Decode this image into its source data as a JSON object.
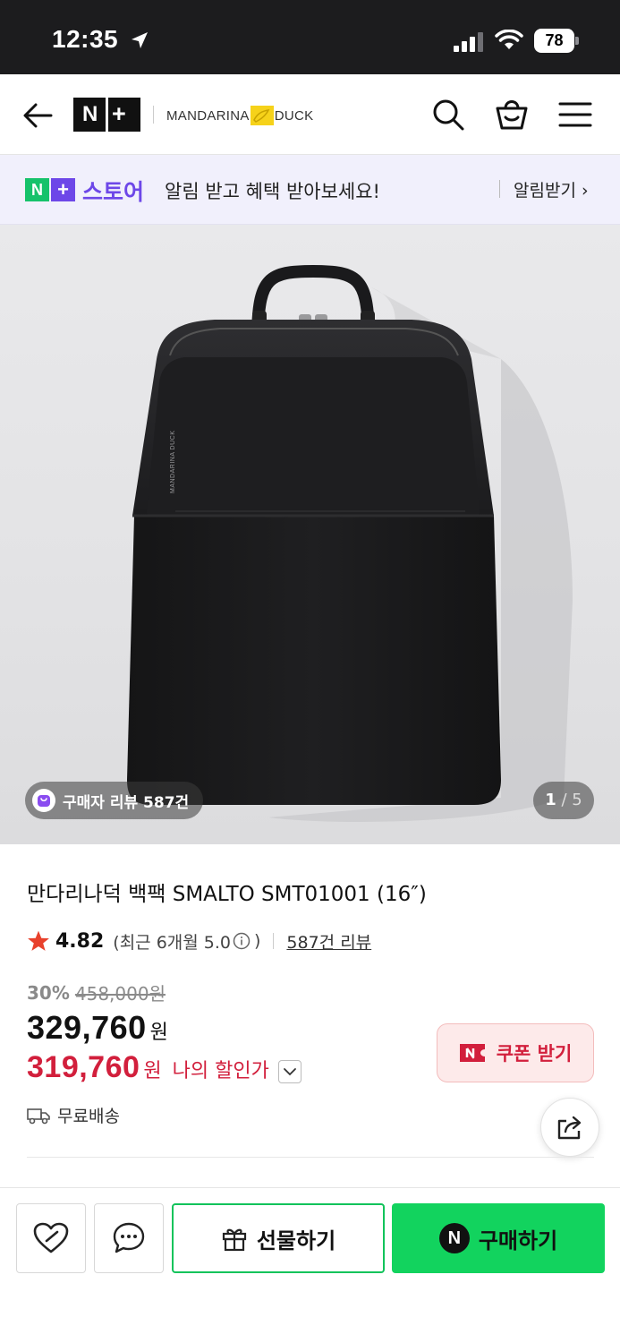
{
  "status_bar": {
    "time": "12:35",
    "battery": "78"
  },
  "header": {
    "logo_text_n": "N",
    "logo_text_plus": "+",
    "brand_left": "MANDARINA",
    "brand_right": "DUCK"
  },
  "store_banner": {
    "badge_n": "N",
    "badge_plus": "+",
    "label": "스토어",
    "message": "알림 받고 혜택 받아보세요!",
    "action": "알림받기 ›"
  },
  "gallery": {
    "review_chip": "구매자 리뷰 587건",
    "current_page": "1",
    "total_pages": "/ 5",
    "bag_print": "MANDARINA DUCK"
  },
  "product": {
    "title": "만다리나덕 백팩 SMALTO SMT01001 (16″)",
    "rating": "4.82",
    "rating_recent": "(최근 6개월 5.0",
    "rating_recent_close": ")",
    "review_link": "587건 리뷰",
    "discount_pct": "30%",
    "original_price": "458,000원",
    "price": "329,760",
    "price_unit": "원",
    "my_price": "319,760",
    "my_price_unit": "원",
    "my_price_label": "나의 할인가",
    "coupon_label": "쿠폰 받기",
    "shipping": "무료배송"
  },
  "bottom_bar": {
    "gift_label": "선물하기",
    "buy_n": "N",
    "buy_label": "구매하기"
  },
  "colors": {
    "accent_green": "#12d35e",
    "store_purple": "#6d47e8",
    "price_red": "#d21f3c",
    "rating_star": "#e8412c"
  }
}
